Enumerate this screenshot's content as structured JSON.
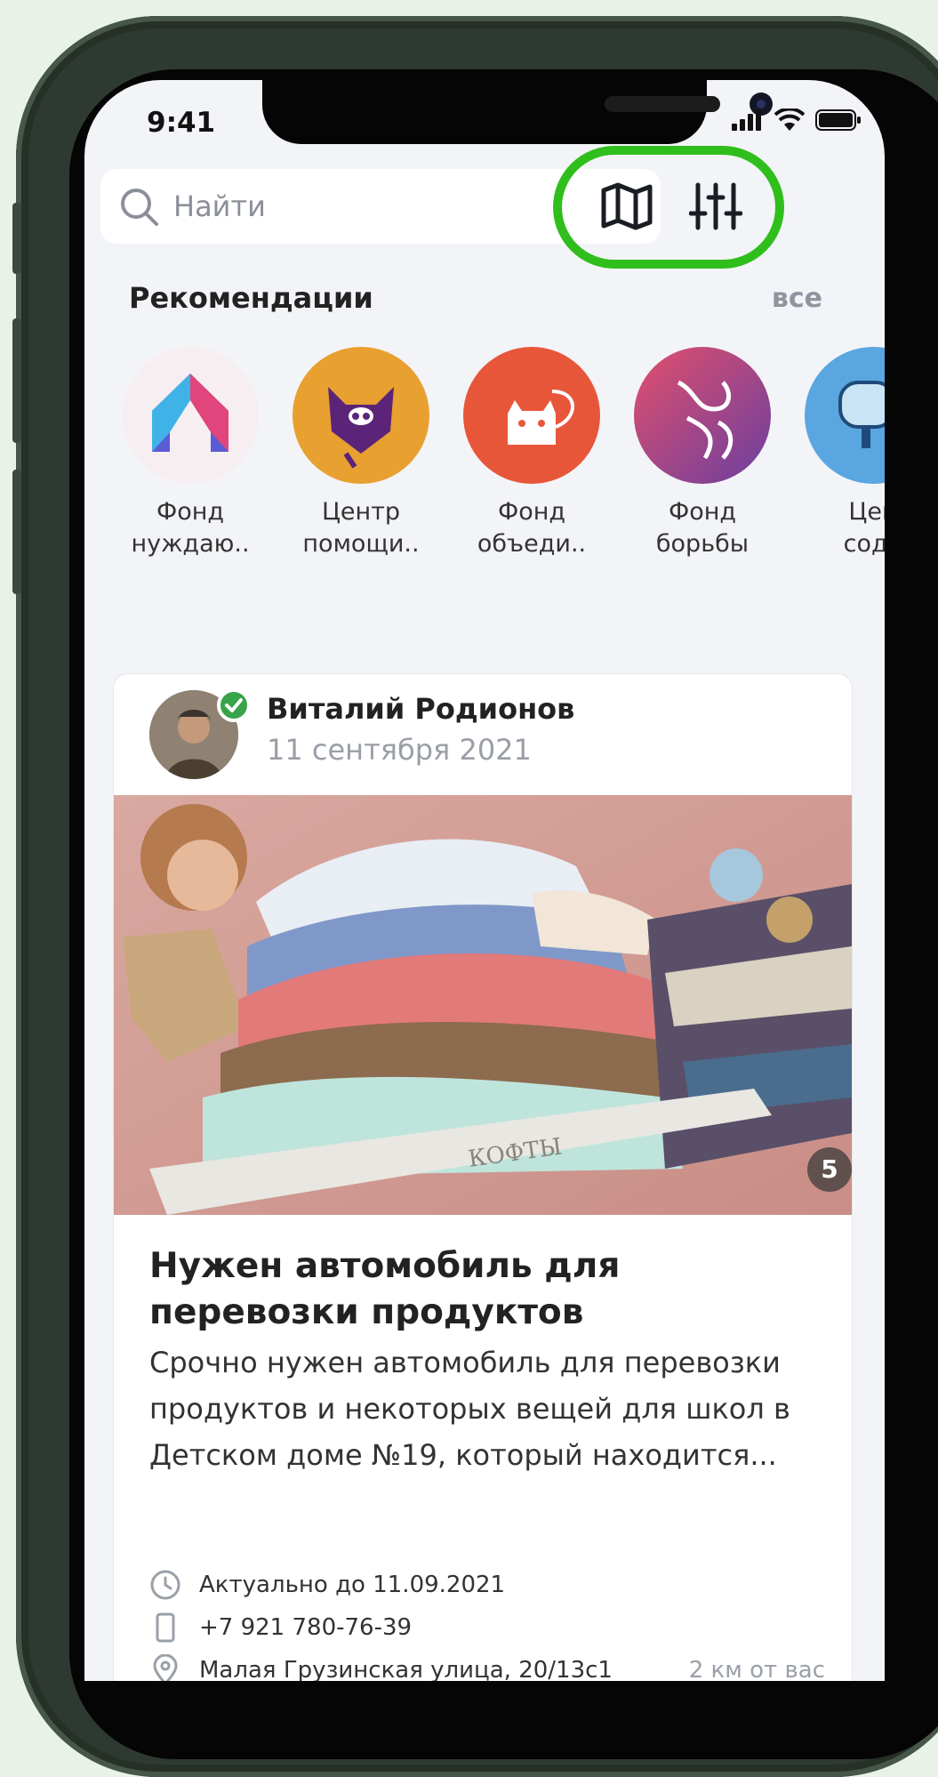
{
  "status_bar": {
    "time": "9:41"
  },
  "search": {
    "placeholder": "Найти"
  },
  "recommendations": {
    "title": "Рекомендации",
    "all_label": "все",
    "items": [
      {
        "label": "Фонд\nнуждаю..",
        "icon": "house-logo-icon",
        "color": "#f7eef2"
      },
      {
        "label": "Центр\nпомощи..",
        "icon": "owl-logo-icon",
        "color": "#e8a030"
      },
      {
        "label": "Фонд\nобъеди..",
        "icon": "cat-logo-icon",
        "color": "#e8563a"
      },
      {
        "label": "Фонд\nборьбы",
        "icon": "deer-logo-icon",
        "color": "#c94b5f"
      },
      {
        "label": "Цен\nсоде",
        "icon": "tree-logo-icon",
        "color": "#5aa6e0"
      }
    ]
  },
  "post": {
    "author": "Виталий Родионов",
    "date": "11 сентября 2021",
    "photo_count": "5",
    "photo_caption_text": "КОФТЫ",
    "title": "Нужен автомобиль для перевозки продуктов",
    "text": "Срочно нужен автомобиль для перевозки продуктов и некоторых вещей для школ в Детском доме №19, который находится...",
    "deadline": "Актуально до 11.09.2021",
    "phone": "+7 921 780-76-39",
    "address": "Малая Грузинская улица, 20/13с1",
    "distance": "2 км от вас"
  },
  "colors": {
    "highlight": "#2fbe1c",
    "background": "#e9f2e7",
    "screen": "#f3f4f7"
  }
}
